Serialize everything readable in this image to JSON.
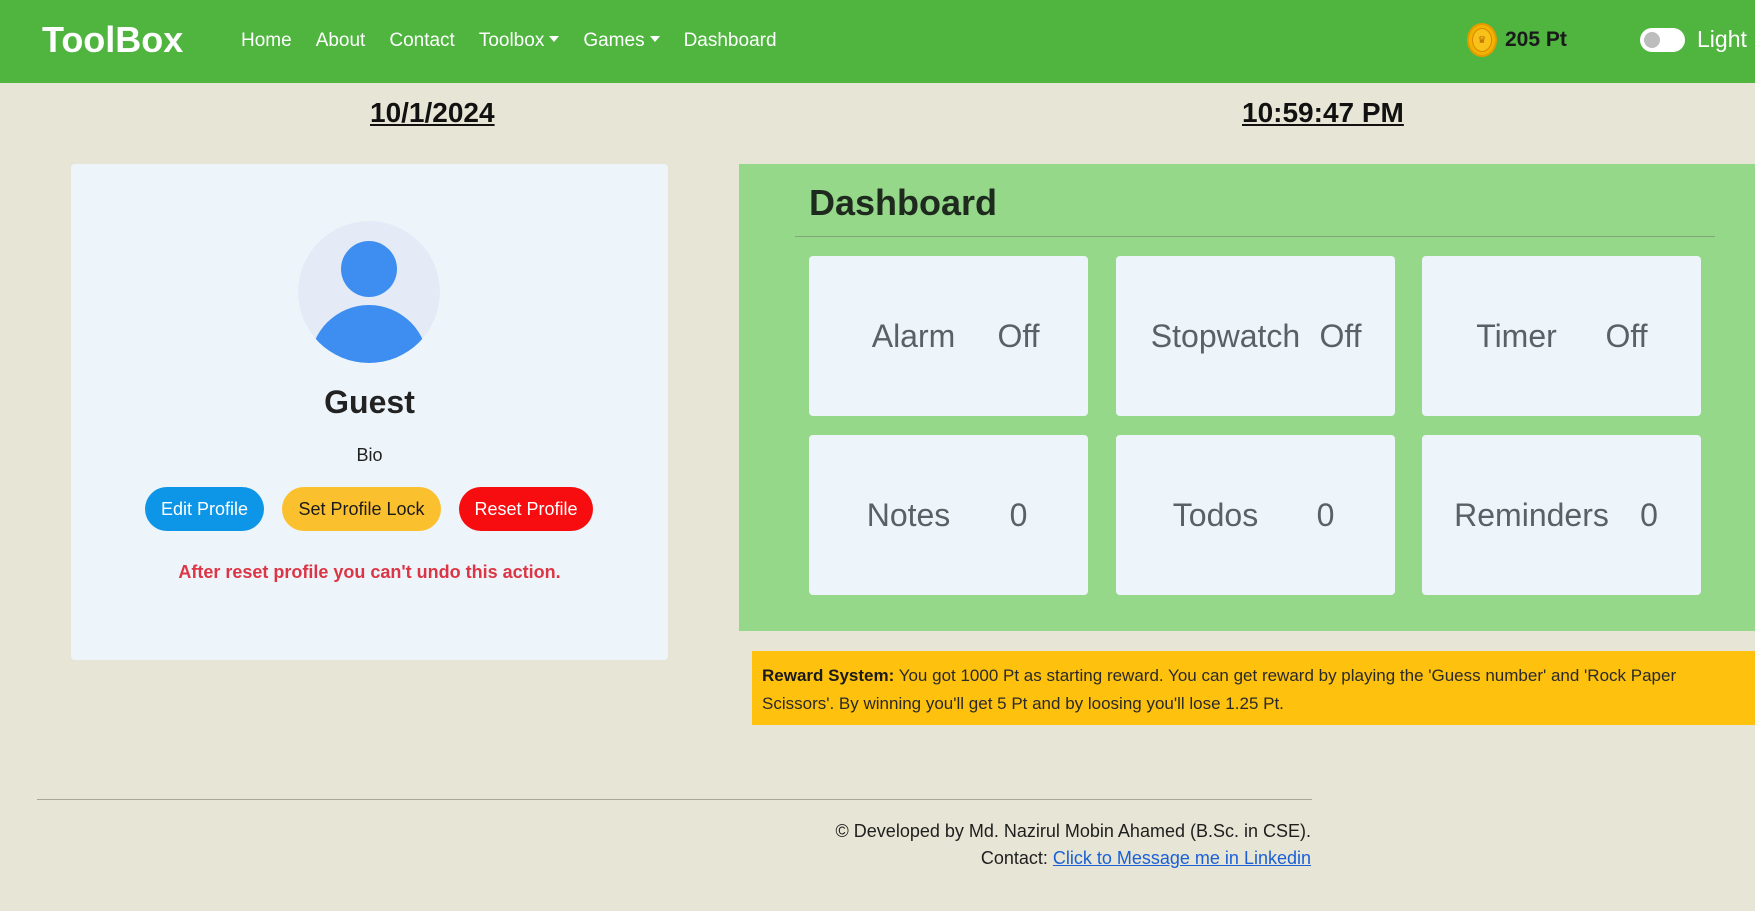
{
  "navbar": {
    "brand": "ToolBox",
    "links": [
      {
        "label": "Home"
      },
      {
        "label": "About"
      },
      {
        "label": "Contact"
      },
      {
        "label": "Toolbox",
        "dropdown": true
      },
      {
        "label": "Games",
        "dropdown": true
      },
      {
        "label": "Dashboard"
      }
    ],
    "points": "205 Pt",
    "theme_label": "Light",
    "theme_toggle_on": false
  },
  "datetime": {
    "date": "10/1/2024",
    "time": "10:59:47 PM"
  },
  "profile": {
    "name": "Guest",
    "bio": "Bio",
    "edit_label": "Edit Profile",
    "lock_label": "Set Profile Lock",
    "reset_label": "Reset Profile",
    "warning": "After reset profile you can't undo this action."
  },
  "dashboard": {
    "title": "Dashboard",
    "tiles": [
      {
        "label": "Alarm",
        "value": "Off"
      },
      {
        "label": "Stopwatch",
        "value": "Off"
      },
      {
        "label": "Timer",
        "value": "Off"
      },
      {
        "label": "Notes",
        "value": "0"
      },
      {
        "label": "Todos",
        "value": "0"
      },
      {
        "label": "Reminders",
        "value": "0"
      }
    ]
  },
  "reward": {
    "heading": "Reward System:",
    "text": " You got 1000 Pt as starting reward. You can get reward by playing the 'Guess number' and 'Rock Paper Scissors'. By winning you'll get 5 Pt and by loosing you'll lose 1.25 Pt."
  },
  "footer": {
    "credit": "© Developed by Md. Nazirul Mobin Ahamed (B.Sc. in CSE).",
    "contact_prefix": "Contact: ",
    "contact_link": "Click to Message me in Linkedin"
  },
  "colors": {
    "navbar": "#4fb53f",
    "background": "#e7e6d6",
    "dashboard": "#95d889",
    "edit_button": "#0d95e8",
    "lock_button": "#fbc02d",
    "reset_button": "#f70d10",
    "reward": "#fec10e"
  }
}
